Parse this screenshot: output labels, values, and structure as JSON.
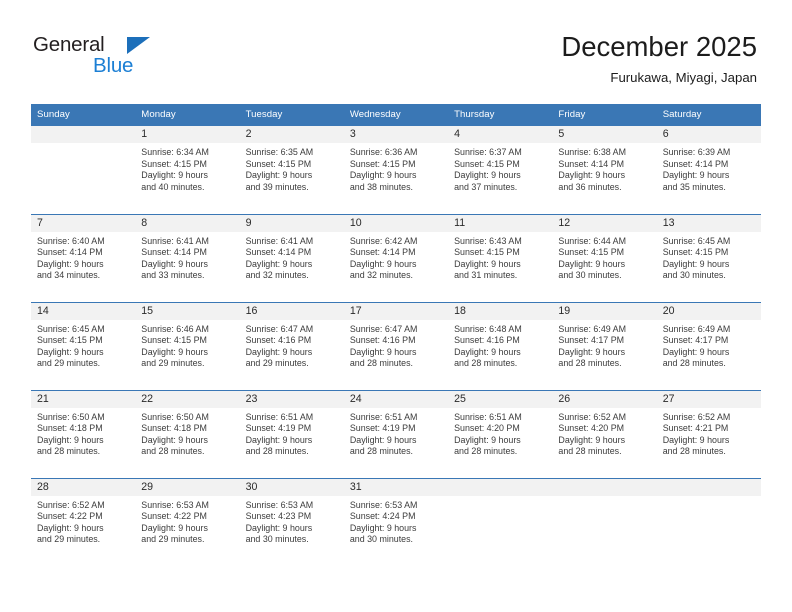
{
  "logo": {
    "text_dark": "General",
    "text_blue": "Blue",
    "triangle_color": "#1c6fba",
    "blue_color": "#1c7fd4"
  },
  "header": {
    "title": "December 2025",
    "location": "Furukawa, Miyagi, Japan"
  },
  "theme": {
    "header_bg": "#3a77b5",
    "daynum_bg": "#f2f2f2",
    "text_color": "#3c3c3c"
  },
  "weekday_headers": [
    "Sunday",
    "Monday",
    "Tuesday",
    "Wednesday",
    "Thursday",
    "Friday",
    "Saturday"
  ],
  "weeks": [
    [
      {
        "day": "",
        "sunrise": "",
        "sunset": "",
        "daylight_line1": "",
        "daylight_line2": ""
      },
      {
        "day": "1",
        "sunrise": "Sunrise: 6:34 AM",
        "sunset": "Sunset: 4:15 PM",
        "daylight_line1": "Daylight: 9 hours",
        "daylight_line2": "and 40 minutes."
      },
      {
        "day": "2",
        "sunrise": "Sunrise: 6:35 AM",
        "sunset": "Sunset: 4:15 PM",
        "daylight_line1": "Daylight: 9 hours",
        "daylight_line2": "and 39 minutes."
      },
      {
        "day": "3",
        "sunrise": "Sunrise: 6:36 AM",
        "sunset": "Sunset: 4:15 PM",
        "daylight_line1": "Daylight: 9 hours",
        "daylight_line2": "and 38 minutes."
      },
      {
        "day": "4",
        "sunrise": "Sunrise: 6:37 AM",
        "sunset": "Sunset: 4:15 PM",
        "daylight_line1": "Daylight: 9 hours",
        "daylight_line2": "and 37 minutes."
      },
      {
        "day": "5",
        "sunrise": "Sunrise: 6:38 AM",
        "sunset": "Sunset: 4:14 PM",
        "daylight_line1": "Daylight: 9 hours",
        "daylight_line2": "and 36 minutes."
      },
      {
        "day": "6",
        "sunrise": "Sunrise: 6:39 AM",
        "sunset": "Sunset: 4:14 PM",
        "daylight_line1": "Daylight: 9 hours",
        "daylight_line2": "and 35 minutes."
      }
    ],
    [
      {
        "day": "7",
        "sunrise": "Sunrise: 6:40 AM",
        "sunset": "Sunset: 4:14 PM",
        "daylight_line1": "Daylight: 9 hours",
        "daylight_line2": "and 34 minutes."
      },
      {
        "day": "8",
        "sunrise": "Sunrise: 6:41 AM",
        "sunset": "Sunset: 4:14 PM",
        "daylight_line1": "Daylight: 9 hours",
        "daylight_line2": "and 33 minutes."
      },
      {
        "day": "9",
        "sunrise": "Sunrise: 6:41 AM",
        "sunset": "Sunset: 4:14 PM",
        "daylight_line1": "Daylight: 9 hours",
        "daylight_line2": "and 32 minutes."
      },
      {
        "day": "10",
        "sunrise": "Sunrise: 6:42 AM",
        "sunset": "Sunset: 4:14 PM",
        "daylight_line1": "Daylight: 9 hours",
        "daylight_line2": "and 32 minutes."
      },
      {
        "day": "11",
        "sunrise": "Sunrise: 6:43 AM",
        "sunset": "Sunset: 4:15 PM",
        "daylight_line1": "Daylight: 9 hours",
        "daylight_line2": "and 31 minutes."
      },
      {
        "day": "12",
        "sunrise": "Sunrise: 6:44 AM",
        "sunset": "Sunset: 4:15 PM",
        "daylight_line1": "Daylight: 9 hours",
        "daylight_line2": "and 30 minutes."
      },
      {
        "day": "13",
        "sunrise": "Sunrise: 6:45 AM",
        "sunset": "Sunset: 4:15 PM",
        "daylight_line1": "Daylight: 9 hours",
        "daylight_line2": "and 30 minutes."
      }
    ],
    [
      {
        "day": "14",
        "sunrise": "Sunrise: 6:45 AM",
        "sunset": "Sunset: 4:15 PM",
        "daylight_line1": "Daylight: 9 hours",
        "daylight_line2": "and 29 minutes."
      },
      {
        "day": "15",
        "sunrise": "Sunrise: 6:46 AM",
        "sunset": "Sunset: 4:15 PM",
        "daylight_line1": "Daylight: 9 hours",
        "daylight_line2": "and 29 minutes."
      },
      {
        "day": "16",
        "sunrise": "Sunrise: 6:47 AM",
        "sunset": "Sunset: 4:16 PM",
        "daylight_line1": "Daylight: 9 hours",
        "daylight_line2": "and 29 minutes."
      },
      {
        "day": "17",
        "sunrise": "Sunrise: 6:47 AM",
        "sunset": "Sunset: 4:16 PM",
        "daylight_line1": "Daylight: 9 hours",
        "daylight_line2": "and 28 minutes."
      },
      {
        "day": "18",
        "sunrise": "Sunrise: 6:48 AM",
        "sunset": "Sunset: 4:16 PM",
        "daylight_line1": "Daylight: 9 hours",
        "daylight_line2": "and 28 minutes."
      },
      {
        "day": "19",
        "sunrise": "Sunrise: 6:49 AM",
        "sunset": "Sunset: 4:17 PM",
        "daylight_line1": "Daylight: 9 hours",
        "daylight_line2": "and 28 minutes."
      },
      {
        "day": "20",
        "sunrise": "Sunrise: 6:49 AM",
        "sunset": "Sunset: 4:17 PM",
        "daylight_line1": "Daylight: 9 hours",
        "daylight_line2": "and 28 minutes."
      }
    ],
    [
      {
        "day": "21",
        "sunrise": "Sunrise: 6:50 AM",
        "sunset": "Sunset: 4:18 PM",
        "daylight_line1": "Daylight: 9 hours",
        "daylight_line2": "and 28 minutes."
      },
      {
        "day": "22",
        "sunrise": "Sunrise: 6:50 AM",
        "sunset": "Sunset: 4:18 PM",
        "daylight_line1": "Daylight: 9 hours",
        "daylight_line2": "and 28 minutes."
      },
      {
        "day": "23",
        "sunrise": "Sunrise: 6:51 AM",
        "sunset": "Sunset: 4:19 PM",
        "daylight_line1": "Daylight: 9 hours",
        "daylight_line2": "and 28 minutes."
      },
      {
        "day": "24",
        "sunrise": "Sunrise: 6:51 AM",
        "sunset": "Sunset: 4:19 PM",
        "daylight_line1": "Daylight: 9 hours",
        "daylight_line2": "and 28 minutes."
      },
      {
        "day": "25",
        "sunrise": "Sunrise: 6:51 AM",
        "sunset": "Sunset: 4:20 PM",
        "daylight_line1": "Daylight: 9 hours",
        "daylight_line2": "and 28 minutes."
      },
      {
        "day": "26",
        "sunrise": "Sunrise: 6:52 AM",
        "sunset": "Sunset: 4:20 PM",
        "daylight_line1": "Daylight: 9 hours",
        "daylight_line2": "and 28 minutes."
      },
      {
        "day": "27",
        "sunrise": "Sunrise: 6:52 AM",
        "sunset": "Sunset: 4:21 PM",
        "daylight_line1": "Daylight: 9 hours",
        "daylight_line2": "and 28 minutes."
      }
    ],
    [
      {
        "day": "28",
        "sunrise": "Sunrise: 6:52 AM",
        "sunset": "Sunset: 4:22 PM",
        "daylight_line1": "Daylight: 9 hours",
        "daylight_line2": "and 29 minutes."
      },
      {
        "day": "29",
        "sunrise": "Sunrise: 6:53 AM",
        "sunset": "Sunset: 4:22 PM",
        "daylight_line1": "Daylight: 9 hours",
        "daylight_line2": "and 29 minutes."
      },
      {
        "day": "30",
        "sunrise": "Sunrise: 6:53 AM",
        "sunset": "Sunset: 4:23 PM",
        "daylight_line1": "Daylight: 9 hours",
        "daylight_line2": "and 30 minutes."
      },
      {
        "day": "31",
        "sunrise": "Sunrise: 6:53 AM",
        "sunset": "Sunset: 4:24 PM",
        "daylight_line1": "Daylight: 9 hours",
        "daylight_line2": "and 30 minutes."
      },
      {
        "day": "",
        "sunrise": "",
        "sunset": "",
        "daylight_line1": "",
        "daylight_line2": ""
      },
      {
        "day": "",
        "sunrise": "",
        "sunset": "",
        "daylight_line1": "",
        "daylight_line2": ""
      },
      {
        "day": "",
        "sunrise": "",
        "sunset": "",
        "daylight_line1": "",
        "daylight_line2": ""
      }
    ]
  ]
}
